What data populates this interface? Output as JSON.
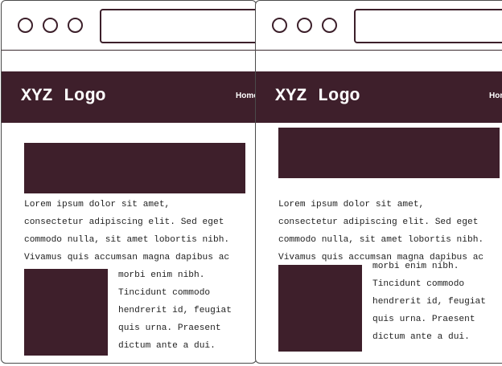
{
  "colors": {
    "brand": "#3e1f2b",
    "outline": "#3c1f2a",
    "background": "#ffffff",
    "text": "#222222"
  },
  "windows": [
    {
      "logo": "XYZ Logo",
      "nav_label": "Home",
      "paragraph_lines": [
        "Lorem ipsum dolor sit amet,",
        "consectetur adipiscing elit. Sed eget",
        "commodo nulla, sit amet lobortis nibh.",
        "Vivamus quis accumsan magna dapibus ac"
      ],
      "wrap_lines": [
        "morbi enim nibh.",
        "Tincidunt commodo",
        "hendrerit id, feugiat",
        "quis urna. Praesent",
        "dictum ante a dui."
      ]
    },
    {
      "logo": "XYZ Logo",
      "nav_label": "Home",
      "paragraph_lines": [
        "Lorem ipsum dolor sit amet,",
        "consectetur adipiscing elit. Sed eget",
        "commodo nulla, sit amet lobortis nibh.",
        "Vivamus quis accumsan magna dapibus ac"
      ],
      "wrap_lines": [
        "morbi enim nibh.",
        "Tincidunt commodo",
        "hendrerit id, feugiat",
        "quis urna. Praesent",
        "dictum ante a dui."
      ]
    }
  ]
}
